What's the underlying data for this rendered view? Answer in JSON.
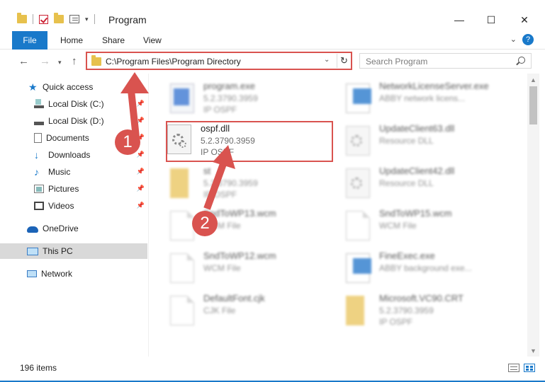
{
  "window": {
    "title": "Program",
    "controls": {
      "minimize": "—",
      "maximize": "☐",
      "close": "✕"
    }
  },
  "ribbon": {
    "tabs": [
      "File",
      "Home",
      "Share",
      "View"
    ],
    "help": "?"
  },
  "address": {
    "path": "C:\\Program Files\\Program Directory",
    "search_placeholder": "Search Program"
  },
  "sidebar": {
    "items": [
      {
        "label": "Quick access",
        "icon": "star-icon"
      },
      {
        "label": "Local Disk (C:)",
        "icon": "drive-icon",
        "pinned": true
      },
      {
        "label": "Local Disk (D:)",
        "icon": "drive-icon",
        "pinned": true
      },
      {
        "label": "Documents",
        "icon": "documents-icon",
        "pinned": true
      },
      {
        "label": "Downloads",
        "icon": "download-icon",
        "pinned": true
      },
      {
        "label": "Music",
        "icon": "music-icon",
        "pinned": true
      },
      {
        "label": "Pictures",
        "icon": "pictures-icon",
        "pinned": true
      },
      {
        "label": "Videos",
        "icon": "videos-icon",
        "pinned": true
      },
      {
        "label": "OneDrive",
        "icon": "cloud-icon"
      },
      {
        "label": "This PC",
        "icon": "computer-icon",
        "selected": true
      },
      {
        "label": "Network",
        "icon": "network-icon"
      }
    ]
  },
  "files": {
    "left": [
      {
        "name": "program.exe",
        "line1": "5.2.3790.3959",
        "line2": "IP OSPF",
        "icon": "exe-icon"
      },
      {
        "name": "ospf.dll",
        "line1": "5.2.3790.3959",
        "line2": "IP OSPF",
        "icon": "dll-icon"
      },
      {
        "name": "st",
        "line1": "5.2.3790.3959",
        "line2": "IP OSPF",
        "icon": "folder-icon"
      },
      {
        "name": "SndToWP13.wcm",
        "line1": "WCM File",
        "line2": "",
        "icon": "file-icon"
      },
      {
        "name": "SndToWP12.wcm",
        "line1": "WCM File",
        "line2": "",
        "icon": "file-icon"
      },
      {
        "name": "DefaultFont.cjk",
        "line1": "CJK File",
        "line2": "",
        "icon": "file-icon"
      }
    ],
    "right": [
      {
        "name": "NetworkLicenseServer.exe",
        "line1": "ABBY network licens...",
        "line2": "",
        "icon": "exe-icon"
      },
      {
        "name": "UpdateClient63.dll",
        "line1": "Resource DLL",
        "line2": "",
        "icon": "dll-icon"
      },
      {
        "name": "UpdateClient42.dll",
        "line1": "Resource DLL",
        "line2": "",
        "icon": "dll-icon"
      },
      {
        "name": "SndToWP15.wcm",
        "line1": "WCM File",
        "line2": "",
        "icon": "file-icon"
      },
      {
        "name": "FineExec.exe",
        "line1": "ABBY background exe...",
        "line2": "",
        "icon": "exe-icon"
      },
      {
        "name": "Microsoft.VC90.CRT",
        "line1": "5.2.3790.3959",
        "line2": "IP OSPF",
        "icon": "folder-icon"
      }
    ]
  },
  "status": {
    "item_count": "196 items"
  },
  "annotations": {
    "step1": "1",
    "step2": "2"
  },
  "colors": {
    "accent": "#1979ca",
    "highlight": "#d9534f"
  }
}
